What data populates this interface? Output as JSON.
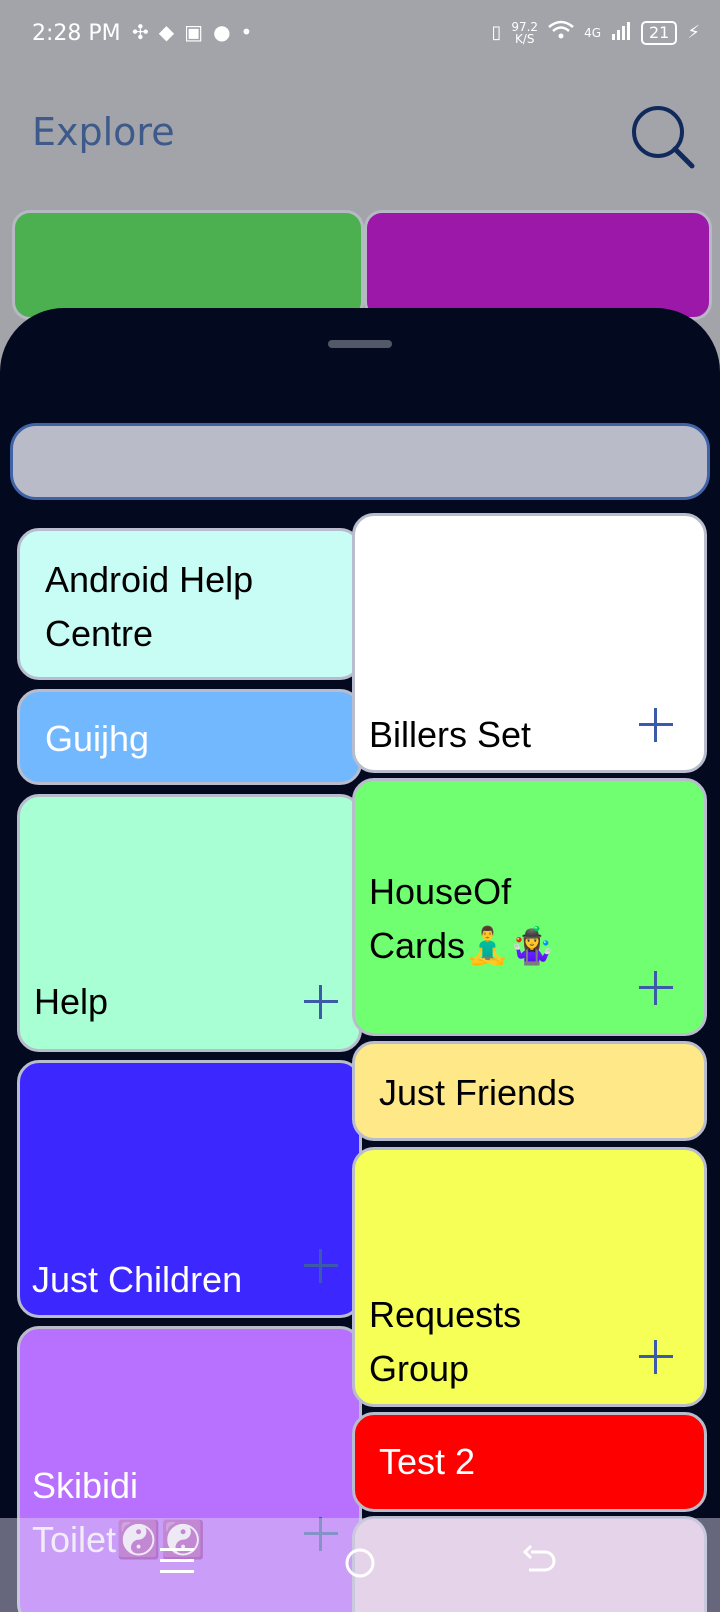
{
  "status_bar": {
    "time": "2:28 PM",
    "net_speed_value": "97.2",
    "net_speed_unit": "K/S",
    "network_type": "4G",
    "battery": "21"
  },
  "header": {
    "title": "Explore"
  },
  "cards": {
    "android_help_centre": "Android Help Centre",
    "billers_set": "Billers Set",
    "guijhg": "Guijhg",
    "help": "Help",
    "house_of_cards": "HouseOf Cards🧘‍♂️🤹‍♀️",
    "just_children": "Just Children",
    "just_friends": "Just Friends",
    "requests_group": "Requests Group",
    "skibidi_toilet": "Skibidi Toilet☯️☯️",
    "test_2": "Test 2"
  },
  "colors": {
    "android_help_centre": "#c8fdf5",
    "billers_set": "#ffffff",
    "guijhg": "#72b8ff",
    "help": "#a8ffd3",
    "house_of_cards": "#70ff70",
    "just_children": "#3c28ff",
    "just_friends": "#ffe887",
    "requests_group": "#f6ff55",
    "skibidi_toilet": "#b870ff",
    "test_2": "#ff0000"
  }
}
